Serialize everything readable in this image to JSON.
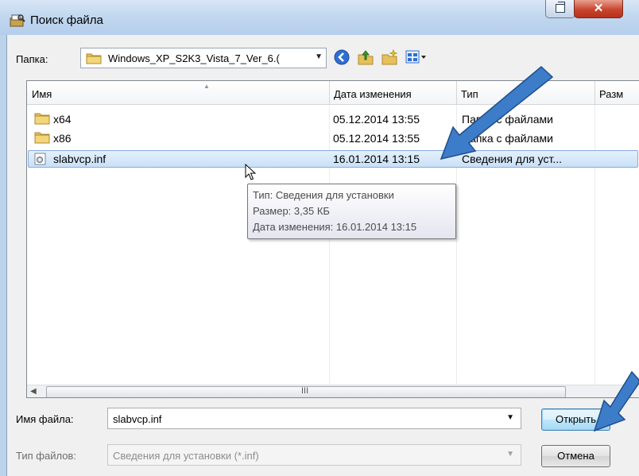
{
  "window": {
    "title": "Поиск файла"
  },
  "toolbar": {
    "folder_label": "Папка:",
    "current_path": "Windows_XP_S2K3_Vista_7_Ver_6.("
  },
  "columns": [
    {
      "label": "Имя"
    },
    {
      "label": "Дата изменения"
    },
    {
      "label": "Тип"
    },
    {
      "label": "Разм"
    }
  ],
  "files": [
    {
      "name": "x64",
      "date": "05.12.2014 13:55",
      "type": "Папка с файлами",
      "icon": "folder-icon"
    },
    {
      "name": "x86",
      "date": "05.12.2014 13:55",
      "type": "Папка с файлами",
      "icon": "folder-icon"
    },
    {
      "name": "slabvcp.inf",
      "date": "16.01.2014 13:15",
      "type": "Сведения для уст...",
      "icon": "inf-file-icon",
      "selected": true
    }
  ],
  "tooltip": {
    "type_line": "Тип: Сведения для установки",
    "size_line": "Размер: 3,35 КБ",
    "date_line": "Дата изменения: 16.01.2014 13:15"
  },
  "scrollbar": {
    "grip": "III"
  },
  "form": {
    "filename_label": "Имя файла:",
    "filename_value": "slabvcp.inf",
    "filetype_label": "Тип файлов:",
    "filetype_value": "Сведения для установки (*.inf)"
  },
  "buttons": {
    "open": "Открыть",
    "cancel": "Отмена"
  },
  "colors": {
    "selection": "#cce4f7",
    "accent_arrow": "#3d7cc9",
    "close_red": "#c8452e"
  }
}
